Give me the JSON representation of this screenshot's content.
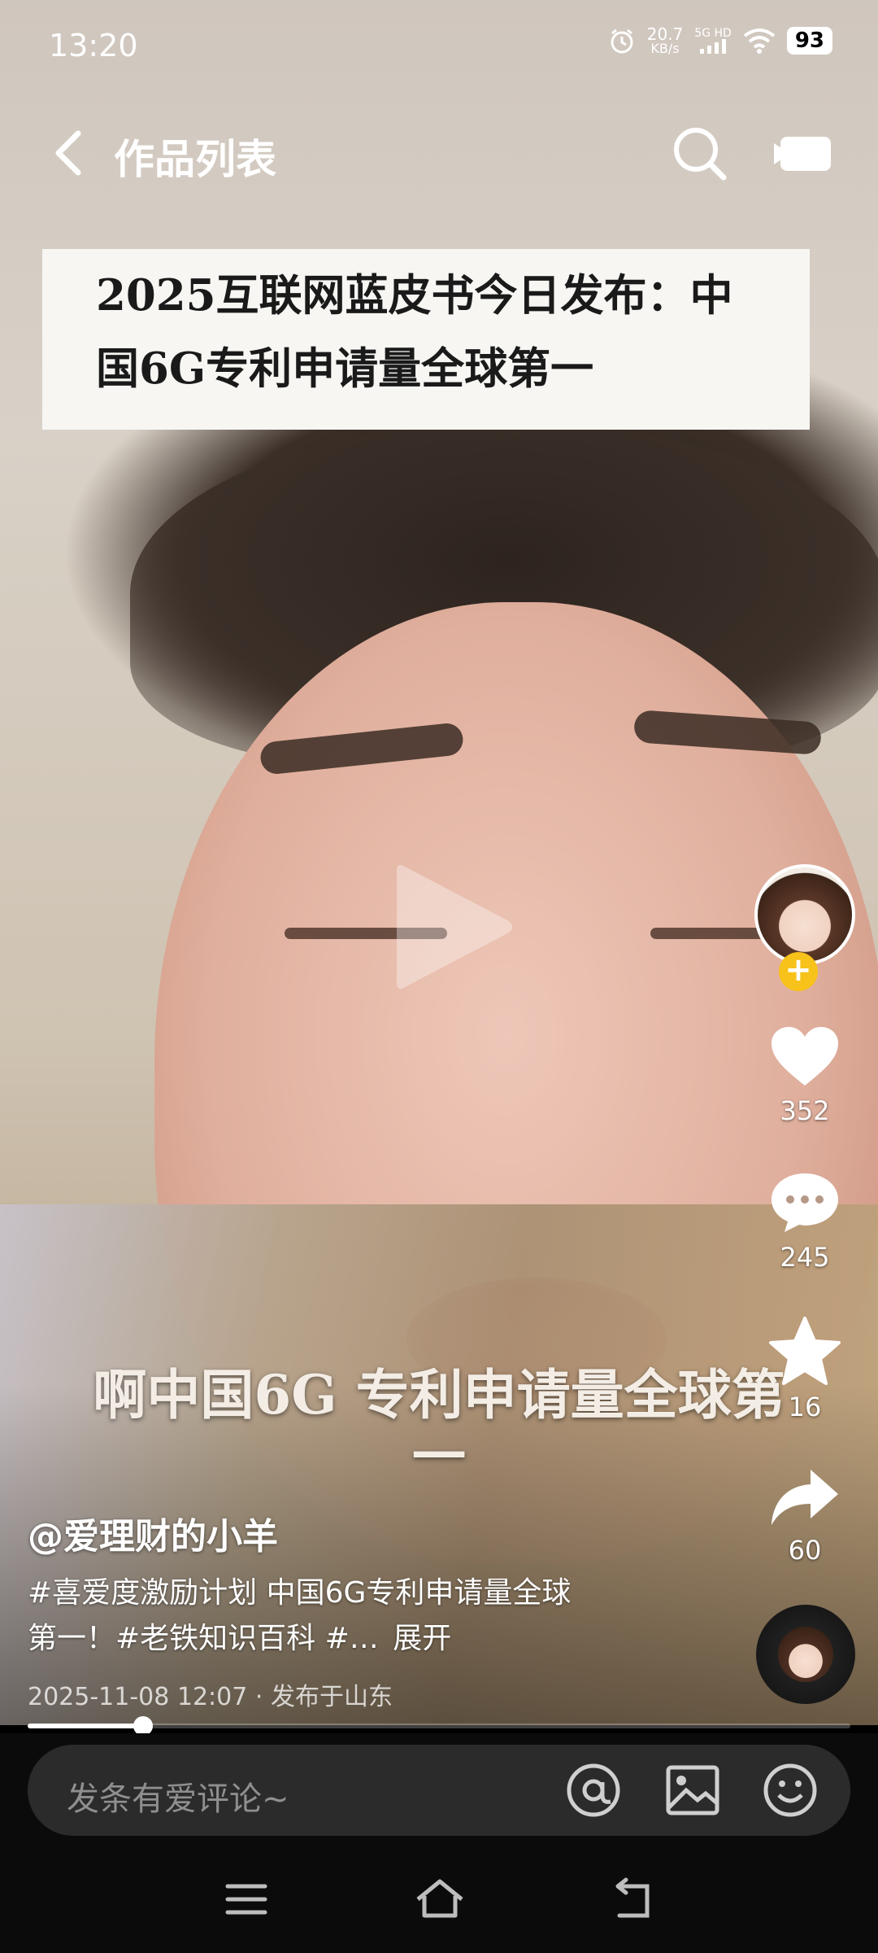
{
  "status_bar": {
    "time": "13:20",
    "net_speed_value": "20.7",
    "net_speed_unit": "KB/s",
    "network": "5G HD",
    "battery": "93"
  },
  "top_nav": {
    "title": "作品列表",
    "icons": [
      "back-icon",
      "search-icon",
      "camera-icon"
    ]
  },
  "video": {
    "headline": "2025互联网蓝皮书今日发布：中国6G专利申请量全球第一",
    "subtitle": "啊中国6G 专利申请量全球第一"
  },
  "actions": {
    "likes": "352",
    "comments": "245",
    "favorites": "16",
    "shares": "60",
    "follow_symbol": "+"
  },
  "caption": {
    "author": "@爱理财的小羊",
    "description": "#喜爱度激励计划 中国6G专利申请量全球第一！#老铁知识百科 #…",
    "expand": "展开",
    "meta": "2025-11-08 12:07 · 发布于山东"
  },
  "progress": {
    "fraction": 0.14
  },
  "comment_bar": {
    "placeholder": "发条有爱评论~",
    "icons": [
      "at-icon",
      "image-icon",
      "emoji-icon"
    ]
  },
  "nav_bar": {
    "icons": [
      "menu-icon",
      "home-icon",
      "back-nav-icon"
    ]
  },
  "colors": {
    "follow_badge": "#f7c21a",
    "comment_bg": "#2b2b2b",
    "banner_bg": "#f7f6f3"
  }
}
